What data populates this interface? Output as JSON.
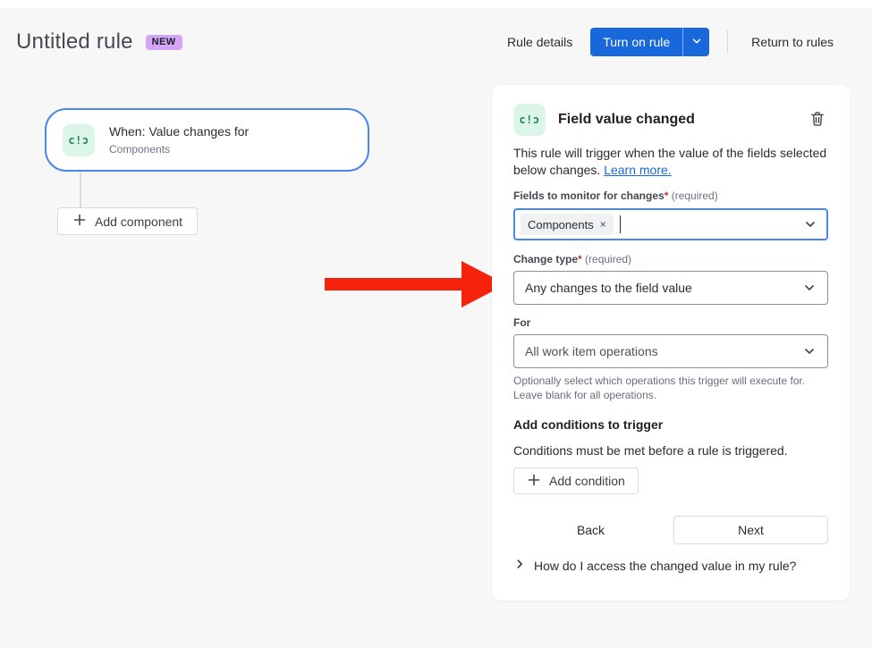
{
  "header": {
    "title": "Untitled rule",
    "badge": "NEW",
    "rule_details_label": "Rule details",
    "turn_on_label": "Turn on rule",
    "return_label": "Return to rules"
  },
  "canvas": {
    "trigger_card": {
      "icon": "field-value-changed-icon",
      "icon_glyph": "c!ɔ",
      "title": "When: Value changes for",
      "subtitle": "Components"
    },
    "add_component_label": "Add component"
  },
  "panel": {
    "icon_glyph": "c!ɔ",
    "title": "Field value changed",
    "description": "This rule will trigger when the value of the fields selected below changes.",
    "learn_more_label": "Learn more.",
    "asterisk": "*",
    "required_suffix": "(required)",
    "fields_label": "Fields to monitor for changes",
    "field_tag": "Components",
    "tag_remove": "×",
    "change_type_label": "Change type",
    "change_type_value": "Any changes to the field value",
    "for_label": "For",
    "for_value": "All work item operations",
    "for_help_line1": "Optionally select which operations this trigger will execute for.",
    "for_help_line2": "Leave blank for all operations.",
    "conditions_title": "Add conditions to trigger",
    "conditions_desc": "Conditions must be met before a rule is triggered.",
    "add_condition_label": "Add condition",
    "back_label": "Back",
    "next_label": "Next",
    "faq_label": "How do I access the changed value in my rule?"
  },
  "colors": {
    "accent_blue": "#1868db",
    "focus_border_blue": "#4688ec",
    "arrow_red": "#f5230b",
    "badge_purple": "#d3a5f6",
    "icon_green": "#1f845a",
    "icon_green_bg": "#dcf5e9",
    "link_blue": "#1868db",
    "page_bg": "#f7f7f8"
  }
}
